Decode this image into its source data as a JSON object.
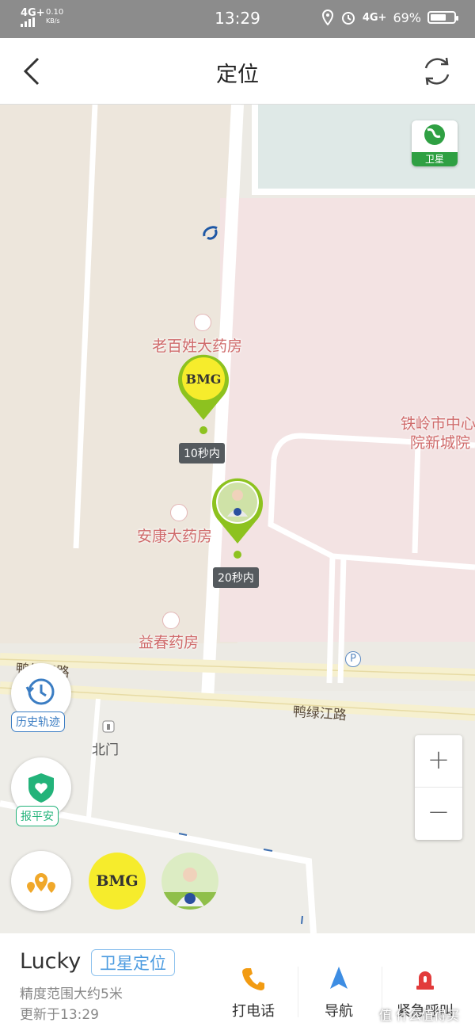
{
  "status_bar": {
    "signal": "4G+",
    "net_speed": "0.10",
    "net_unit": "KB/s",
    "time": "13:29",
    "network2": "4G+",
    "battery_percent": "69%",
    "battery_level": 0.69
  },
  "header": {
    "title": "定位"
  },
  "map": {
    "satellite_button_label": "卫星",
    "pois": [
      {
        "name": "老百姓大药房"
      },
      {
        "name": "安康大药房"
      },
      {
        "name": "益春药房"
      },
      {
        "name": "铁岭市中心"
      },
      {
        "name": "院新城院"
      }
    ],
    "roads": {
      "road_left": "鸭绿江路",
      "road_right": "鸭绿江路"
    },
    "gate_label": "北门",
    "markers": [
      {
        "avatar_text": "BMG",
        "time_tag": "10秒内"
      },
      {
        "time_tag": "20秒内"
      }
    ],
    "history_label": "历史轨迹",
    "safe_label": "报平安",
    "zoom_in": "+",
    "zoom_out": "−",
    "device_switch_bmg": "BMG"
  },
  "panel": {
    "name": "Lucky",
    "mode": "卫星定位",
    "accuracy": "精度范围大约5米",
    "updated": "更新于13:29",
    "actions": [
      {
        "label": "打电话",
        "icon": "phone-icon",
        "color": "#f29b12"
      },
      {
        "label": "导航",
        "icon": "navigation-icon",
        "color": "#3d8de3"
      },
      {
        "label": "紧急呼叫",
        "icon": "alarm-icon",
        "color": "#e23b3b"
      }
    ],
    "watermark": "值 什么值得买"
  },
  "colors": {
    "accent_green": "#8dc21f",
    "satellite_green": "#2fa043",
    "poi_text": "#cf6b6b",
    "mode_blue": "#4b9be0"
  }
}
